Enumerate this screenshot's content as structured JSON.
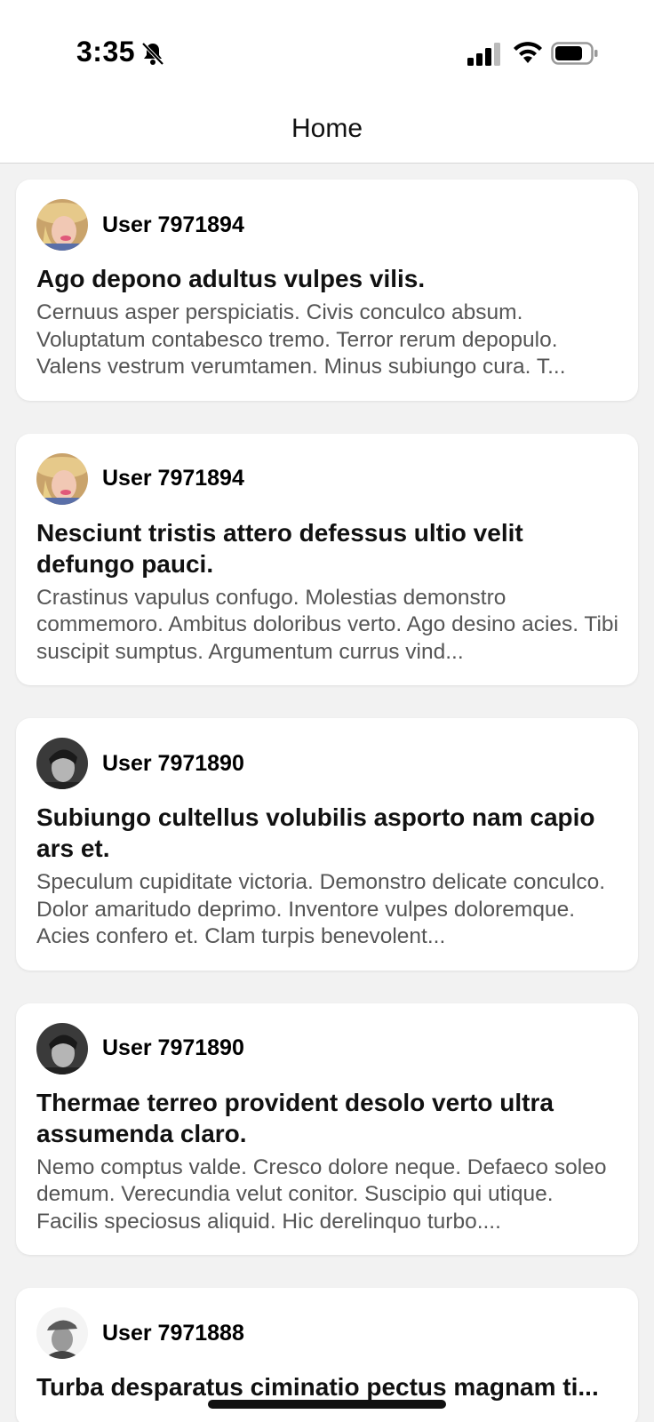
{
  "status_bar": {
    "time": "3:35",
    "icons": [
      "bell-slash-icon",
      "cellular-signal-icon",
      "wifi-icon",
      "battery-icon"
    ]
  },
  "nav": {
    "title": "Home"
  },
  "posts": [
    {
      "username": "User 7971894",
      "avatar": "avatar-blonde-hat",
      "title": "Ago depono adultus vulpes vilis.",
      "body": "Cernuus asper perspiciatis. Civis conculco absum. Voluptatum contabesco tremo. Terror rerum depopulo. Valens vestrum verumtamen. Minus subiungo cura. T..."
    },
    {
      "username": "User 7971894",
      "avatar": "avatar-blonde-hat",
      "title": "Nesciunt tristis attero defessus ultio velit defungo pauci.",
      "body": "Crastinus vapulus confugo. Molestias demonstro commemoro. Ambitus doloribus verto. Ago desino acies. Tibi suscipit sumptus. Argumentum currus vind..."
    },
    {
      "username": "User 7971890",
      "avatar": "avatar-dark-hair-bw",
      "title": "Subiungo cultellus volubilis asporto nam capio ars et.",
      "body": "Speculum cupiditate victoria. Demonstro delicate conculco. Dolor amaritudo deprimo. Inventore vulpes doloremque. Acies confero et. Clam turpis benevolent..."
    },
    {
      "username": "User 7971890",
      "avatar": "avatar-dark-hair-bw",
      "title": "Thermae terreo provident desolo verto ultra assumenda claro.",
      "body": "Nemo comptus valde. Cresco dolore neque. Defaeco soleo demum. Verecundia velut conitor. Suscipio qui utique. Facilis speciosus aliquid. Hic derelinquo turbo...."
    },
    {
      "username": "User 7971888",
      "avatar": "avatar-cap-bw",
      "title": "Turba desparatus ciminatio pectus magnam ti...",
      "body": ""
    }
  ],
  "colors": {
    "background": "#f2f2f2",
    "card": "#ffffff",
    "text_primary": "#111111",
    "text_secondary": "#555555"
  }
}
